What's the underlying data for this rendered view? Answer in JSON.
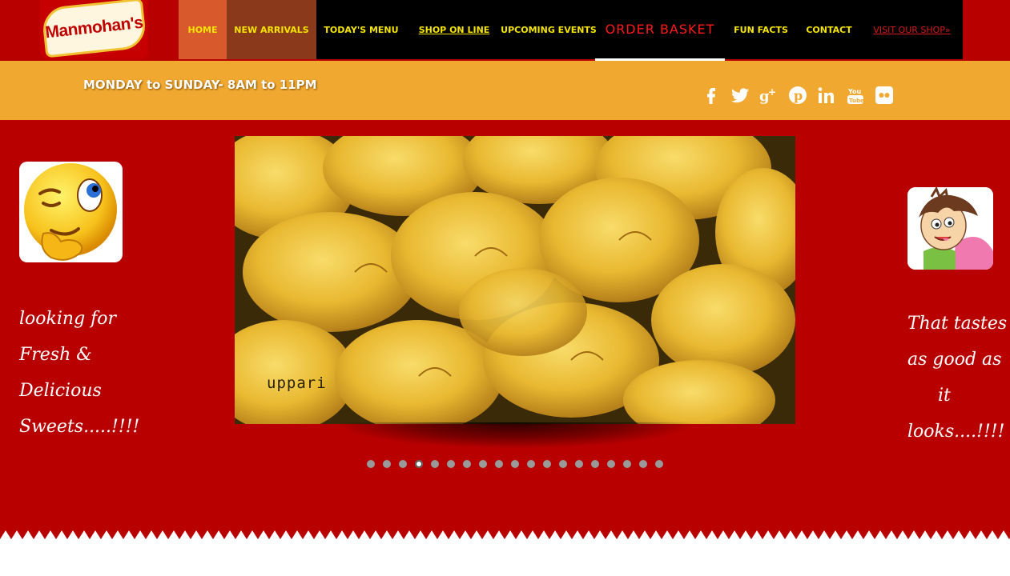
{
  "logo": {
    "text": "Manmohan's"
  },
  "nav": {
    "items": [
      {
        "label": "HOME"
      },
      {
        "label": "NEW ARRIVALS"
      },
      {
        "label": "TODAY'S MENU"
      },
      {
        "label": "SHOP ON LINE"
      },
      {
        "label": "UPCOMING EVENTS"
      },
      {
        "label": "ORDER BASKET"
      },
      {
        "label": "FUN FACTS"
      },
      {
        "label": "CONTACT"
      },
      {
        "label": "VISIT OUR SHOP»"
      }
    ]
  },
  "hours": {
    "text": "MONDAY to SUNDAY- 8AM to 11PM"
  },
  "social": [
    "facebook-icon",
    "twitter-icon",
    "google-plus-icon",
    "pinterest-icon",
    "linkedin-icon",
    "youtube-icon",
    "flickr-icon"
  ],
  "left_panel": {
    "lines": [
      "looking for",
      "Fresh &",
      "Delicious",
      "Sweets.....!!!!"
    ]
  },
  "right_panel": {
    "lines": [
      "That tastes",
      "as good as",
      "it",
      "looks....!!!!"
    ]
  },
  "slider": {
    "caption": "uppari",
    "dot_count": 19,
    "active_dot": 3
  },
  "colors": {
    "background": "#b80000",
    "nav_bg": "#000000",
    "nav_text": "#f5e400",
    "hours_bar": "#f0a830",
    "basket_text": "#ff1a1a"
  }
}
